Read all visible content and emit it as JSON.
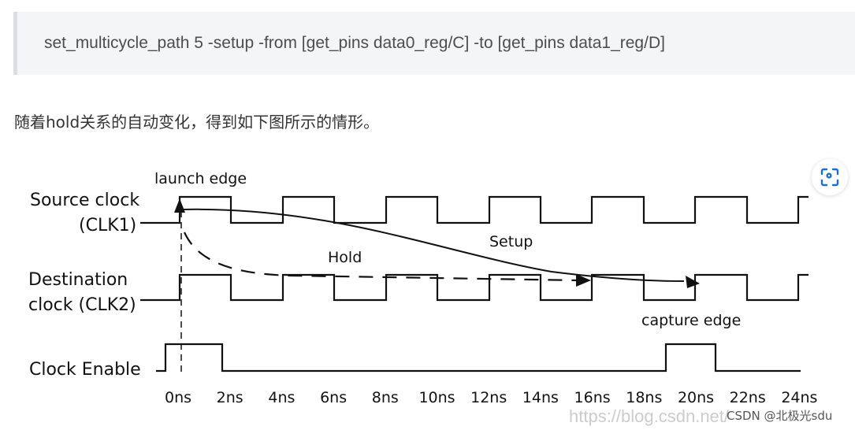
{
  "code_block": {
    "text": "set_multicycle_path 5 -setup -from [get_pins data0_reg/C] -to [get_pins data1_reg/D]"
  },
  "paragraph": "随着hold关系的自动变化，得到如下图所示的情形。",
  "diagram": {
    "labels": {
      "launch_edge": "launch edge",
      "source_clock_line1": "Source clock",
      "source_clock_line2": "(CLK1)",
      "dest_clock_line1": "Destination",
      "dest_clock_line2": "clock (CLK2)",
      "clock_enable": "Clock Enable",
      "hold": "Hold",
      "setup": "Setup",
      "capture_edge": "capture edge"
    },
    "time_ticks": [
      "0ns",
      "2ns",
      "4ns",
      "6ns",
      "8ns",
      "10ns",
      "12ns",
      "14ns",
      "16ns",
      "18ns",
      "20ns",
      "22ns",
      "24ns"
    ],
    "watermark": "https://blog.csdn.net/",
    "credit": "CSDN @北极光sdu"
  },
  "scan_button": {
    "icon": "scan-icon",
    "color": "#1a6fd6"
  }
}
